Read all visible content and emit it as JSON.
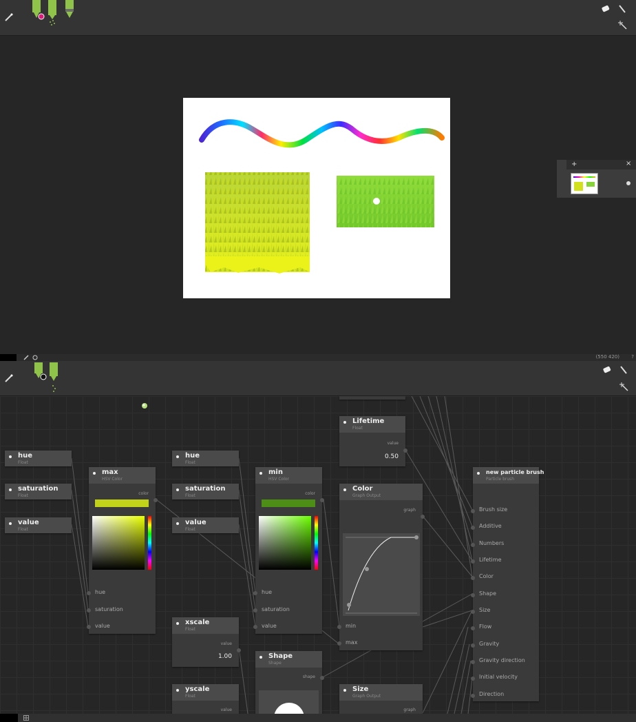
{
  "app": {
    "icons": {
      "top_left": "magic-wand-icon",
      "brushes": [
        "marker-icon",
        "spray-marker-icon",
        "pen-icon"
      ],
      "top_right": [
        "eraser-icon",
        "brush-pick-icon",
        "wand-sparkle-icon"
      ]
    },
    "colors": {
      "accent_green": "#8fc34a",
      "selected_color": "#e0187a"
    }
  },
  "status": {
    "coords": "(550 420)",
    "help": "?"
  },
  "layers_panel": {
    "add": "+",
    "close": "×"
  },
  "nodes": {
    "hue1": {
      "title": "hue",
      "sub": "Float"
    },
    "sat1": {
      "title": "saturation",
      "sub": "Float"
    },
    "val1": {
      "title": "value",
      "sub": "Float"
    },
    "max": {
      "title": "max",
      "sub": "HSV Color",
      "out": "color",
      "in1": "hue",
      "in2": "saturation",
      "in3": "value",
      "swatch": "#c2d21a"
    },
    "hue2": {
      "title": "hue",
      "sub": "Float"
    },
    "sat2": {
      "title": "saturation",
      "sub": "Float"
    },
    "val2": {
      "title": "value",
      "sub": "Float"
    },
    "min": {
      "title": "min",
      "sub": "HSV Color",
      "out": "color",
      "in1": "hue",
      "in2": "saturation",
      "in3": "value",
      "swatch": "#4c8e16"
    },
    "lifetime": {
      "title": "Lifetime",
      "sub": "Float",
      "out": "value",
      "value": "0.50"
    },
    "color": {
      "title": "Color",
      "sub": "Graph Output",
      "out": "graph",
      "in1": "min",
      "in2": "max"
    },
    "xscale": {
      "title": "xscale",
      "sub": "Float",
      "out": "value",
      "value": "1.00"
    },
    "yscale": {
      "title": "yscale",
      "sub": "Float",
      "out": "value"
    },
    "shape": {
      "title": "Shape",
      "sub": "Shape",
      "out": "shape"
    },
    "size": {
      "title": "Size",
      "sub": "Graph Output",
      "out": "graph"
    },
    "brush": {
      "title": "new particle brush",
      "sub": "Particle brush",
      "inputs": [
        "Brush size",
        "Additive",
        "Numbers",
        "Lifetime",
        "Color",
        "Shape",
        "Size",
        "Flow",
        "Gravity",
        "Gravity direction",
        "Initial velocity",
        "Direction"
      ]
    }
  }
}
